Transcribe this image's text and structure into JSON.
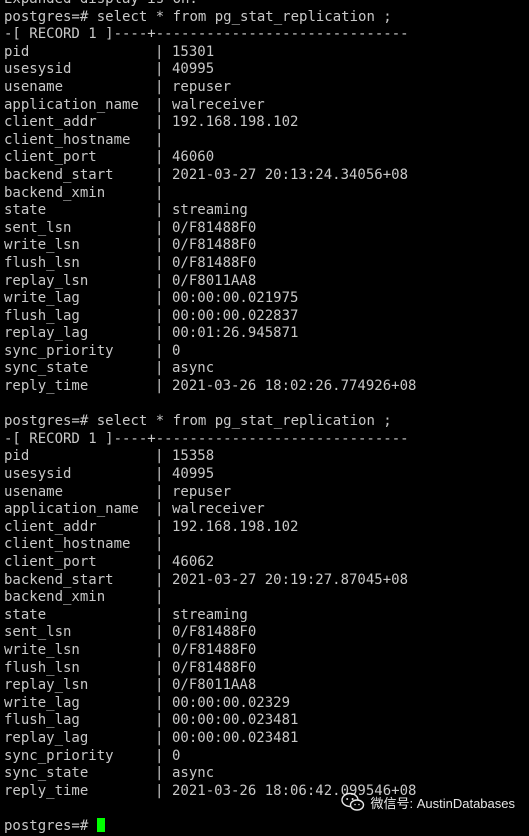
{
  "terminal": {
    "top_partial": "Expanded display is on.",
    "query1": {
      "prompt": "postgres=#",
      "command": " select * from pg_stat_replication ;",
      "record_header": "-[ RECORD 1 ]----+------------------------------",
      "rows": [
        {
          "key": "pid",
          "sep": "|",
          "value": "15301"
        },
        {
          "key": "usesysid",
          "sep": "|",
          "value": "40995"
        },
        {
          "key": "usename",
          "sep": "|",
          "value": "repuser"
        },
        {
          "key": "application_name",
          "sep": "|",
          "value": "walreceiver"
        },
        {
          "key": "client_addr",
          "sep": "|",
          "value": "192.168.198.102"
        },
        {
          "key": "client_hostname",
          "sep": "|",
          "value": ""
        },
        {
          "key": "client_port",
          "sep": "|",
          "value": "46060"
        },
        {
          "key": "backend_start",
          "sep": "|",
          "value": "2021-03-27 20:13:24.34056+08"
        },
        {
          "key": "backend_xmin",
          "sep": "|",
          "value": ""
        },
        {
          "key": "state",
          "sep": "|",
          "value": "streaming"
        },
        {
          "key": "sent_lsn",
          "sep": "|",
          "value": "0/F81488F0"
        },
        {
          "key": "write_lsn",
          "sep": "|",
          "value": "0/F81488F0"
        },
        {
          "key": "flush_lsn",
          "sep": "|",
          "value": "0/F81488F0"
        },
        {
          "key": "replay_lsn",
          "sep": "|",
          "value": "0/F8011AA8"
        },
        {
          "key": "write_lag",
          "sep": "|",
          "value": "00:00:00.021975"
        },
        {
          "key": "flush_lag",
          "sep": "|",
          "value": "00:00:00.022837"
        },
        {
          "key": "replay_lag",
          "sep": "|",
          "value": "00:01:26.945871"
        },
        {
          "key": "sync_priority",
          "sep": "|",
          "value": "0"
        },
        {
          "key": "sync_state",
          "sep": "|",
          "value": "async"
        },
        {
          "key": "reply_time",
          "sep": "|",
          "value": "2021-03-26 18:02:26.774926+08"
        }
      ]
    },
    "query2": {
      "prompt": "postgres=#",
      "command": " select * from pg_stat_replication ;",
      "record_header": "-[ RECORD 1 ]----+------------------------------",
      "rows": [
        {
          "key": "pid",
          "sep": "|",
          "value": "15358"
        },
        {
          "key": "usesysid",
          "sep": "|",
          "value": "40995"
        },
        {
          "key": "usename",
          "sep": "|",
          "value": "repuser"
        },
        {
          "key": "application_name",
          "sep": "|",
          "value": "walreceiver"
        },
        {
          "key": "client_addr",
          "sep": "|",
          "value": "192.168.198.102"
        },
        {
          "key": "client_hostname",
          "sep": "|",
          "value": ""
        },
        {
          "key": "client_port",
          "sep": "|",
          "value": "46062"
        },
        {
          "key": "backend_start",
          "sep": "|",
          "value": "2021-03-27 20:19:27.87045+08"
        },
        {
          "key": "backend_xmin",
          "sep": "|",
          "value": ""
        },
        {
          "key": "state",
          "sep": "|",
          "value": "streaming"
        },
        {
          "key": "sent_lsn",
          "sep": "|",
          "value": "0/F81488F0"
        },
        {
          "key": "write_lsn",
          "sep": "|",
          "value": "0/F81488F0"
        },
        {
          "key": "flush_lsn",
          "sep": "|",
          "value": "0/F81488F0"
        },
        {
          "key": "replay_lsn",
          "sep": "|",
          "value": "0/F8011AA8"
        },
        {
          "key": "write_lag",
          "sep": "|",
          "value": "00:00:00.02329"
        },
        {
          "key": "flush_lag",
          "sep": "|",
          "value": "00:00:00.023481"
        },
        {
          "key": "replay_lag",
          "sep": "|",
          "value": "00:00:00.023481"
        },
        {
          "key": "sync_priority",
          "sep": "|",
          "value": "0"
        },
        {
          "key": "sync_state",
          "sep": "|",
          "value": "async"
        },
        {
          "key": "reply_time",
          "sep": "|",
          "value": "2021-03-26 18:06:42.099546+08"
        }
      ]
    },
    "final_prompt": "postgres=# "
  },
  "watermark": {
    "text": "微信号: AustinDatabases",
    "icon": "wechat-icon"
  },
  "colors": {
    "background": "#000000",
    "text": "#c8c8c8",
    "cursor": "#00ff00"
  }
}
